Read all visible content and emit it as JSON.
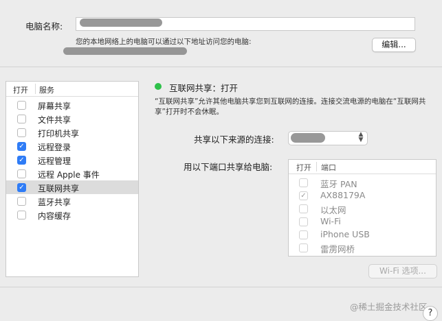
{
  "computer_name": {
    "label": "电脑名称:",
    "hint": "您的本地网络上的电脑可以通过以下地址访问您的电脑:",
    "edit_label": "编辑..."
  },
  "services": {
    "header_on": "打开",
    "header_service": "服务",
    "items": [
      {
        "label": "屏幕共享",
        "checked": false,
        "selected": false
      },
      {
        "label": "文件共享",
        "checked": false,
        "selected": false
      },
      {
        "label": "打印机共享",
        "checked": false,
        "selected": false
      },
      {
        "label": "远程登录",
        "checked": true,
        "selected": false
      },
      {
        "label": "远程管理",
        "checked": true,
        "selected": false
      },
      {
        "label": "远程 Apple 事件",
        "checked": false,
        "selected": false
      },
      {
        "label": "互联网共享",
        "checked": true,
        "selected": true
      },
      {
        "label": "蓝牙共享",
        "checked": false,
        "selected": false
      },
      {
        "label": "内容缓存",
        "checked": false,
        "selected": false
      }
    ]
  },
  "detail": {
    "status": "互联网共享：打开",
    "status_color": "#2ec14a",
    "description": "“互联网共享”允许其他电脑共享您到互联网的连接。连接交流电源的电脑在“互联网共享”打开时不会休眠。",
    "share_from_label": "共享以下来源的连接:",
    "share_to_label": "用以下端口共享给电脑:",
    "ports_header_on": "打开",
    "ports_header_port": "端口",
    "ports": [
      {
        "label": "蓝牙 PAN",
        "checked": false
      },
      {
        "label": "AX88179A",
        "checked": true
      },
      {
        "label": "以太网",
        "checked": false
      },
      {
        "label": "Wi-Fi",
        "checked": false
      },
      {
        "label": "iPhone USB",
        "checked": false
      },
      {
        "label": "雷雳网桥",
        "checked": false
      }
    ],
    "wifi_options_label": "Wi-Fi 选项..."
  },
  "footer": {
    "watermark": "@稀土掘金技术社区",
    "help_label": "?"
  },
  "accent_color": "#2f7cf6"
}
